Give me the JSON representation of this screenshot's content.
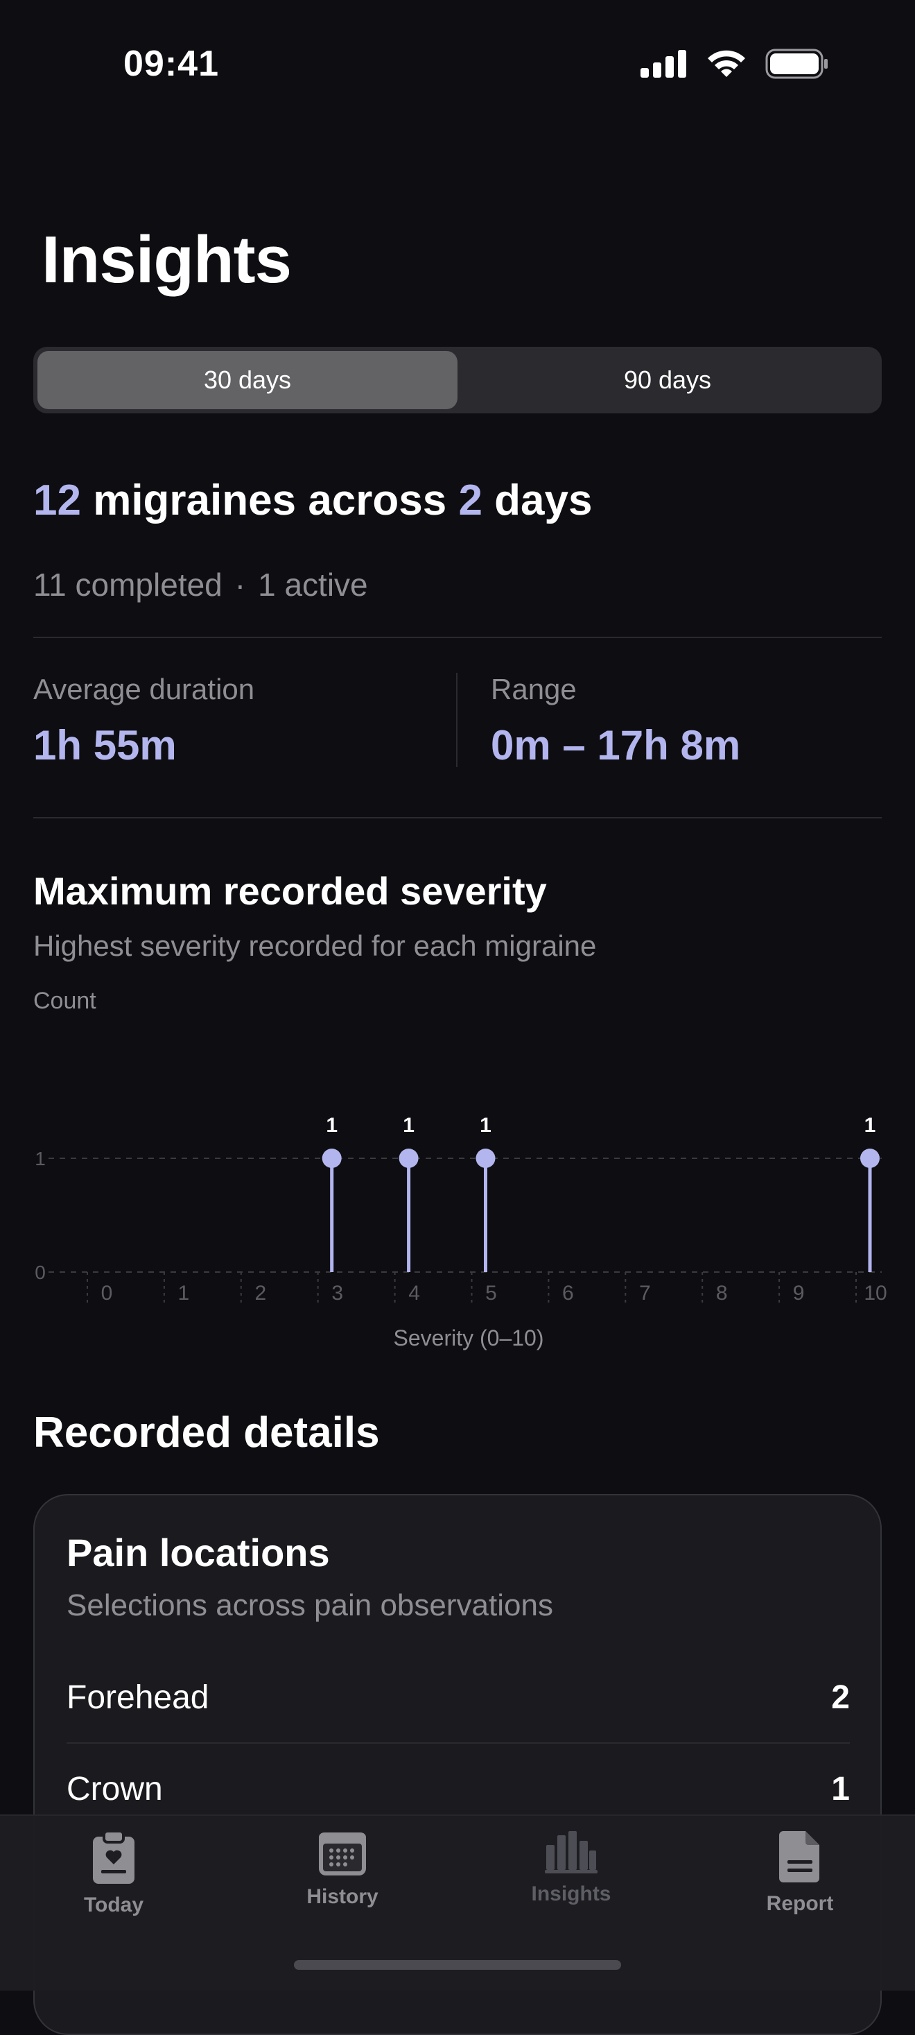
{
  "status_bar": {
    "time": "09:41"
  },
  "page": {
    "title": "Insights"
  },
  "range_picker": {
    "options": [
      {
        "label": "30 days",
        "selected": true
      },
      {
        "label": "90 days",
        "selected": false
      }
    ]
  },
  "summary": {
    "count": "12",
    "middle": " migraines across ",
    "days": "2",
    "suffix": " days",
    "completed": "11 completed",
    "separator": "·",
    "active": "1 active"
  },
  "stats": {
    "average": {
      "label": "Average duration",
      "value": "1h 55m"
    },
    "range": {
      "label": "Range",
      "value": "0m – 17h 8m"
    }
  },
  "severity_section": {
    "title": "Maximum recorded severity",
    "subtitle": "Highest severity recorded for each migraine",
    "count_label": "Count"
  },
  "chart_data": {
    "type": "bar",
    "categories": [
      "0",
      "1",
      "2",
      "3",
      "4",
      "5",
      "6",
      "7",
      "8",
      "9",
      "10"
    ],
    "values": [
      0,
      0,
      0,
      1,
      1,
      1,
      0,
      0,
      0,
      0,
      1
    ],
    "xlabel": "Severity (0–10)",
    "ylabel": "Count",
    "ylim": [
      0,
      1
    ],
    "yticks": [
      "0",
      "1"
    ],
    "grid": true,
    "color": "#b3b6ee"
  },
  "details": {
    "title": "Recorded details",
    "card": {
      "title": "Pain locations",
      "subtitle": "Selections across pain observations",
      "rows": [
        {
          "name": "Forehead",
          "count": "2"
        },
        {
          "name": "Crown",
          "count": "1"
        }
      ]
    }
  },
  "tabbar": {
    "tabs": [
      {
        "label": "Today",
        "icon": "clipboard-heart-icon"
      },
      {
        "label": "History",
        "icon": "calendar-icon"
      },
      {
        "label": "Insights",
        "icon": "bar-chart-icon"
      },
      {
        "label": "Report",
        "icon": "document-icon"
      }
    ]
  }
}
